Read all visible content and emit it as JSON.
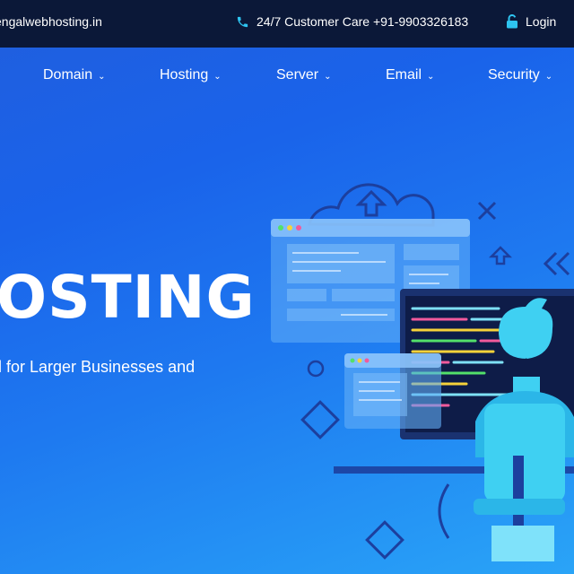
{
  "topbar": {
    "email": "engalwebhosting.in",
    "customer_care": "24/7 Customer Care +91-9903326183",
    "login": "Login"
  },
  "nav": {
    "items": [
      {
        "label": "Domain",
        "icon": "chevron-down-icon"
      },
      {
        "label": "Hosting",
        "icon": "chevron-down-icon"
      },
      {
        "label": "Server",
        "icon": "chevron-down-icon"
      },
      {
        "label": "Email",
        "icon": "chevron-down-icon"
      },
      {
        "label": "Security",
        "icon": "chevron-down-icon"
      }
    ]
  },
  "hero": {
    "headline": "OSTING",
    "subline": "l for Larger Businesses and"
  },
  "colors": {
    "topbar_bg": "#0b1838",
    "hero_gradient_start": "#1f5fe0",
    "hero_gradient_end": "#2aa4f7",
    "accent_cyan": "#2ec4f0",
    "text": "#ffffff"
  }
}
